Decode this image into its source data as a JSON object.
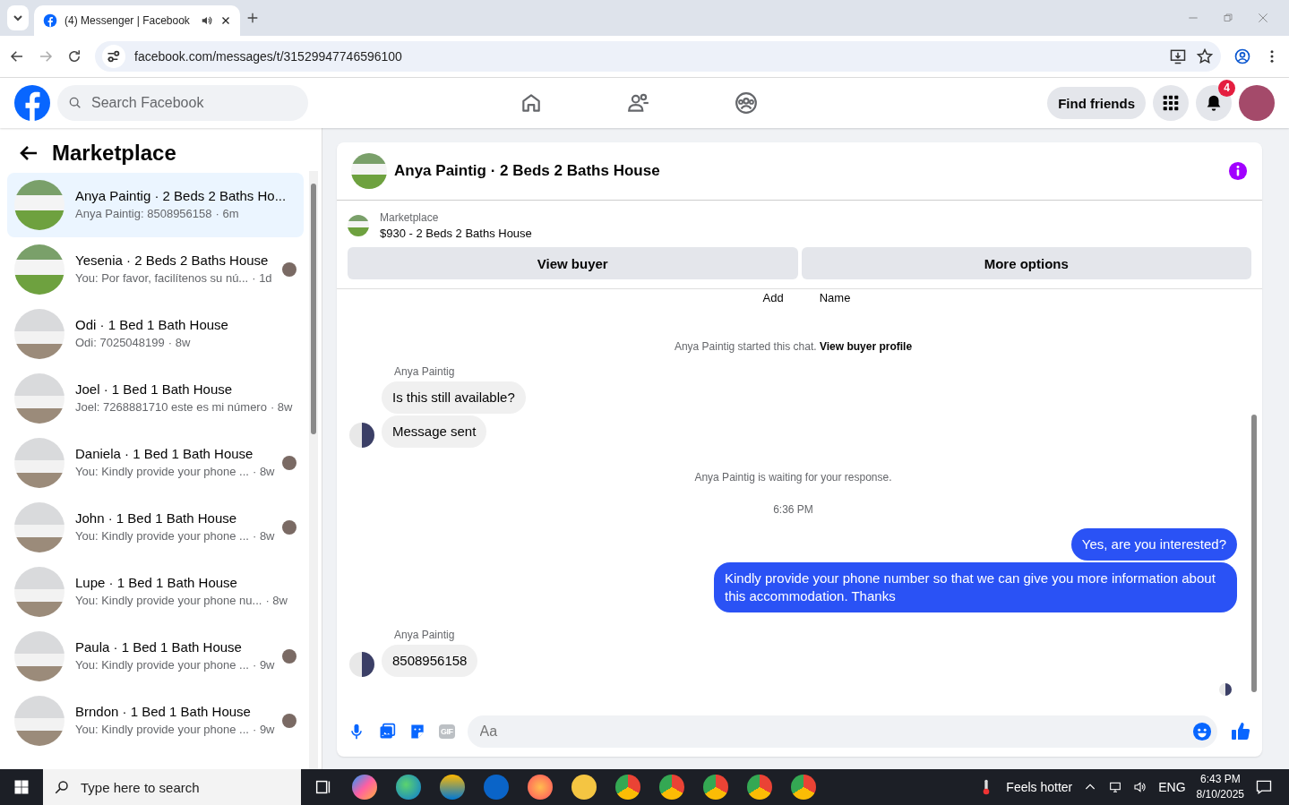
{
  "browser": {
    "tab_title": "(4) Messenger | Facebook",
    "url": "facebook.com/messages/t/31529947746596100"
  },
  "topnav": {
    "search_placeholder": "Search Facebook",
    "find_friends": "Find friends",
    "notification_count": "4"
  },
  "sidebar": {
    "title": "Marketplace",
    "conversations": [
      {
        "title": "Anya Paintig · 2 Beds 2 Baths Ho...",
        "preview": "Anya Paintig: 8508956158",
        "time": "· 6m",
        "selected": true,
        "seen": false
      },
      {
        "title": "Yesenia · 2 Beds 2 Baths House",
        "preview": "You: Por favor, facilítenos su nú...",
        "time": "· 1d",
        "selected": false,
        "seen": true
      },
      {
        "title": "Odi · 1 Bed 1 Bath House",
        "preview": "Odi: 7025048199",
        "time": "· 8w",
        "selected": false,
        "seen": false
      },
      {
        "title": "Joel · 1 Bed 1 Bath House",
        "preview": "Joel: 7268881710 este es mi número",
        "time": "· 8w",
        "selected": false,
        "seen": false
      },
      {
        "title": "Daniela · 1 Bed 1 Bath House",
        "preview": "You: Kindly provide your phone ...",
        "time": "· 8w",
        "selected": false,
        "seen": true
      },
      {
        "title": "John · 1 Bed 1 Bath House",
        "preview": "You: Kindly provide your phone ...",
        "time": "· 8w",
        "selected": false,
        "seen": true
      },
      {
        "title": "Lupe · 1 Bed 1 Bath House",
        "preview": "You: Kindly provide your phone nu...",
        "time": "· 8w",
        "selected": false,
        "seen": false
      },
      {
        "title": "Paula · 1 Bed 1 Bath House",
        "preview": "You: Kindly provide your phone ...",
        "time": "· 9w",
        "selected": false,
        "seen": true
      },
      {
        "title": "Brndon · 1 Bed 1 Bath House",
        "preview": "You: Kindly provide your phone ...",
        "time": "· 9w",
        "selected": false,
        "seen": true
      }
    ]
  },
  "chat": {
    "title": "Anya Paintig · 2 Beds 2 Baths House",
    "listing_label": "Marketplace",
    "listing": "$930 - 2 Beds 2 Baths House",
    "buttons": [
      "View buyer",
      "More options"
    ],
    "top_links": [
      "Add",
      "Name"
    ],
    "messages": [
      {
        "kind": "system",
        "text": "Anya Paintig started this chat.",
        "link": "View buyer profile"
      },
      {
        "kind": "incoming",
        "sender": "Anya Paintig",
        "texts": [
          "Is this still available?",
          "Message sent"
        ]
      },
      {
        "kind": "system",
        "text": "Anya Paintig is waiting for your response."
      },
      {
        "kind": "timestamp",
        "text": "6:36 PM"
      },
      {
        "kind": "outgoing",
        "texts": [
          "Yes, are you interested?",
          "Kindly provide your phone number so that we can give you more information about this accommodation. Thanks"
        ]
      },
      {
        "kind": "incoming",
        "sender": "Anya Paintig",
        "texts": [
          "8508956158"
        ]
      }
    ],
    "composer": {
      "placeholder": "Aa",
      "gif_label": "GIF"
    }
  },
  "taskbar": {
    "search_placeholder": "Type here to search",
    "weather": "Feels hotter",
    "language": "ENG",
    "time": "6:43 PM",
    "date": "8/10/2025"
  }
}
